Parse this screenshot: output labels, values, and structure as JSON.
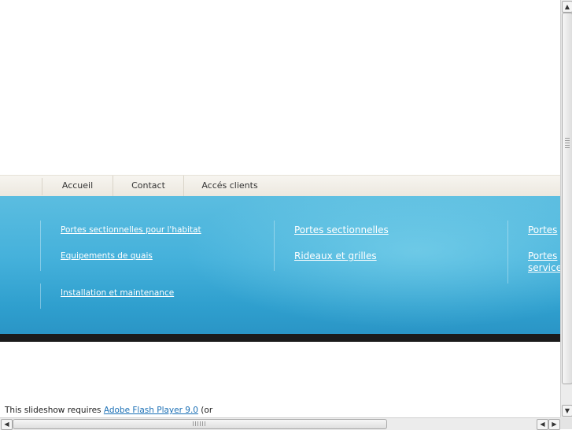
{
  "nav": {
    "items": [
      "Accueil",
      "Contact",
      "Accés clients"
    ]
  },
  "band": {
    "col1": [
      "Portes sectionnelles pour l'habitat",
      "Equipements de quais",
      "Installation et maintenance"
    ],
    "col2": [
      "Portes sectionnelles",
      "Rideaux et grilles"
    ],
    "col3": [
      "Portes",
      "Portes service"
    ]
  },
  "flash": {
    "prefix": "This slideshow requires ",
    "link": "Adobe Flash Player 9.0",
    "suffix": " (or"
  },
  "scrollbar_icons": {
    "up": "▲",
    "down": "▼",
    "left": "◀",
    "right": "▶"
  },
  "colors": {
    "band_top": "#5bbde0",
    "band_bottom": "#2a95c6",
    "link": "#1a6fb5",
    "nav_bg": "#f1eee7"
  }
}
